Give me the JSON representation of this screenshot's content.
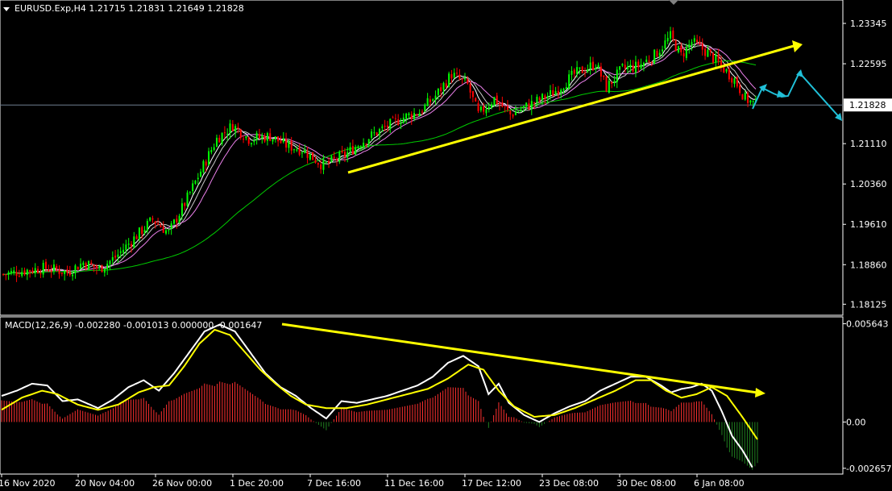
{
  "chart_header": {
    "symbol_line": "EURUSD.Exp,H4  1.21715 1.21831 1.21649 1.21828",
    "menu_icon": "triangle-down-icon"
  },
  "indicator_header": {
    "text": "MACD(12,26,9) -0.002280 -0.001013 0.000000 -0.001647"
  },
  "colors": {
    "background": "#000000",
    "bull_candle": "#00ff00",
    "bear_candle": "#ff0000",
    "ma_fast": "#ffffff",
    "ma_mid": "#c8c8c8",
    "ma_slow": "#ee82ee",
    "ma_long": "#00cc00",
    "trendline": "#ffff00",
    "forecast": "#20c0d8",
    "macd_line": "#ffffff",
    "signal_line": "#ffff00",
    "hist_pos": "#ff3030",
    "hist_neg": "#208020",
    "axis": "#ffffff",
    "current_price_line": "#6f7f8f"
  },
  "chart_data": [
    {
      "type": "candlestick",
      "title": "EURUSD.Exp,H4",
      "current_price": "1.21828",
      "y_ticks": [
        "1.23345",
        "1.22595",
        "1.21110",
        "1.20360",
        "1.19610",
        "1.18860",
        "1.18125"
      ],
      "ylim": [
        1.1795,
        1.2375
      ],
      "x_ticks": [
        "16 Nov 2020",
        "20 Nov 04:00",
        "26 Nov 00:00",
        "1 Dec 20:00",
        "7 Dec 16:00",
        "11 Dec 16:00",
        "17 Dec 12:00",
        "23 Dec 08:00",
        "30 Dec 08:00",
        "6 Jan 08:00"
      ],
      "close_path": [
        [
          0,
          1.1868
        ],
        [
          8,
          1.1875
        ],
        [
          16,
          1.188
        ],
        [
          24,
          1.1872
        ],
        [
          30,
          1.189
        ],
        [
          36,
          1.1878
        ],
        [
          42,
          1.19
        ],
        [
          48,
          1.193
        ],
        [
          56,
          1.197
        ],
        [
          62,
          1.1945
        ],
        [
          68,
          1.2
        ],
        [
          74,
          1.206
        ],
        [
          80,
          1.212
        ],
        [
          86,
          1.2145
        ],
        [
          92,
          1.212
        ],
        [
          100,
          1.2125
        ],
        [
          106,
          1.2108
        ],
        [
          112,
          1.21
        ],
        [
          120,
          1.207
        ],
        [
          128,
          1.209
        ],
        [
          136,
          1.212
        ],
        [
          142,
          1.2138
        ],
        [
          150,
          1.216
        ],
        [
          156,
          1.217
        ],
        [
          162,
          1.22
        ],
        [
          168,
          1.224
        ],
        [
          174,
          1.222
        ],
        [
          178,
          1.2165
        ],
        [
          184,
          1.2195
        ],
        [
          190,
          1.2165
        ],
        [
          198,
          1.2185
        ],
        [
          206,
          1.2205
        ],
        [
          214,
          1.224
        ],
        [
          222,
          1.226
        ],
        [
          226,
          1.2215
        ],
        [
          232,
          1.225
        ],
        [
          238,
          1.2255
        ],
        [
          244,
          1.2275
        ],
        [
          250,
          1.231
        ],
        [
          254,
          1.2275
        ],
        [
          258,
          1.23
        ],
        [
          264,
          1.228
        ],
        [
          268,
          1.226
        ],
        [
          274,
          1.223
        ],
        [
          278,
          1.2195
        ],
        [
          282,
          1.2183
        ]
      ],
      "x_span": 282
    },
    {
      "type": "line",
      "title": "MACD(12,26,9)",
      "y_ticks": [
        "0.005643",
        "0.00",
        "-0.002657"
      ],
      "ylim": [
        -0.00285,
        0.0059
      ],
      "series": [
        {
          "name": "MACD",
          "values": [
            [
              0,
              0.0015
            ],
            [
              6,
              0.0018
            ],
            [
              12,
              0.0022
            ],
            [
              18,
              0.0021
            ],
            [
              24,
              0.0012
            ],
            [
              30,
              0.0013
            ],
            [
              38,
              0.0008
            ],
            [
              44,
              0.0013
            ],
            [
              50,
              0.002
            ],
            [
              56,
              0.0024
            ],
            [
              62,
              0.0018
            ],
            [
              68,
              0.0028
            ],
            [
              74,
              0.004
            ],
            [
              80,
              0.0052
            ],
            [
              86,
              0.0056
            ],
            [
              92,
              0.0052
            ],
            [
              98,
              0.004
            ],
            [
              104,
              0.0028
            ],
            [
              110,
              0.002
            ],
            [
              116,
              0.0015
            ],
            [
              122,
              0.0008
            ],
            [
              128,
              0.0002
            ],
            [
              134,
              0.0012
            ],
            [
              140,
              0.0011
            ],
            [
              146,
              0.0013
            ],
            [
              152,
              0.0015
            ],
            [
              158,
              0.0018
            ],
            [
              164,
              0.0021
            ],
            [
              170,
              0.0026
            ],
            [
              176,
              0.0034
            ],
            [
              182,
              0.0038
            ],
            [
              188,
              0.0032
            ],
            [
              192,
              0.0016
            ],
            [
              196,
              0.0022
            ],
            [
              200,
              0.0011
            ],
            [
              206,
              0.0004
            ],
            [
              212,
              0.0
            ],
            [
              218,
              0.0005
            ],
            [
              224,
              0.0009
            ],
            [
              230,
              0.0012
            ],
            [
              236,
              0.0018
            ],
            [
              242,
              0.0022
            ],
            [
              248,
              0.0026
            ],
            [
              254,
              0.0026
            ],
            [
              260,
              0.0021
            ],
            [
              264,
              0.0017
            ],
            [
              268,
              0.0019
            ],
            [
              272,
              0.002
            ],
            [
              276,
              0.0022
            ],
            [
              280,
              0.0018
            ],
            [
              284,
              0.0006
            ],
            [
              288,
              -0.0008
            ],
            [
              292,
              -0.0016
            ],
            [
              296,
              -0.0026
            ]
          ]
        },
        {
          "name": "Signal",
          "values": [
            [
              0,
              0.0007
            ],
            [
              8,
              0.0014
            ],
            [
              16,
              0.0018
            ],
            [
              22,
              0.0016
            ],
            [
              30,
              0.001
            ],
            [
              38,
              0.0007
            ],
            [
              46,
              0.001
            ],
            [
              54,
              0.0017
            ],
            [
              60,
              0.002
            ],
            [
              66,
              0.0021
            ],
            [
              72,
              0.0032
            ],
            [
              78,
              0.0045
            ],
            [
              84,
              0.0053
            ],
            [
              90,
              0.005
            ],
            [
              96,
              0.004
            ],
            [
              102,
              0.003
            ],
            [
              108,
              0.0022
            ],
            [
              114,
              0.0015
            ],
            [
              120,
              0.001
            ],
            [
              128,
              0.0008
            ],
            [
              136,
              0.0008
            ],
            [
              144,
              0.001
            ],
            [
              152,
              0.0013
            ],
            [
              160,
              0.0016
            ],
            [
              168,
              0.0019
            ],
            [
              176,
              0.0025
            ],
            [
              184,
              0.0033
            ],
            [
              190,
              0.003
            ],
            [
              196,
              0.0018
            ],
            [
              202,
              0.0009
            ],
            [
              210,
              0.0003
            ],
            [
              218,
              0.0004
            ],
            [
              226,
              0.0008
            ],
            [
              234,
              0.0013
            ],
            [
              242,
              0.0018
            ],
            [
              250,
              0.0024
            ],
            [
              256,
              0.0024
            ],
            [
              262,
              0.0018
            ],
            [
              268,
              0.0014
            ],
            [
              274,
              0.0016
            ],
            [
              280,
              0.002
            ],
            [
              286,
              0.0015
            ],
            [
              292,
              0.0003
            ],
            [
              298,
              -0.001
            ]
          ]
        }
      ],
      "x_span": 298
    }
  ]
}
